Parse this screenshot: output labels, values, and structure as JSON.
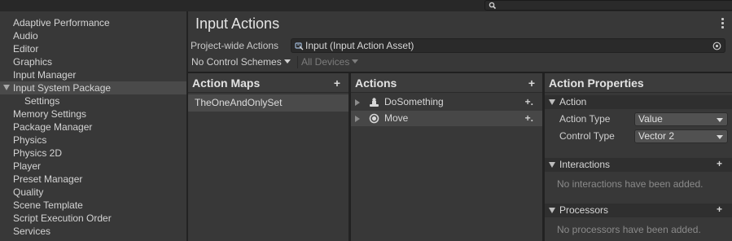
{
  "sidebar": {
    "items": [
      {
        "label": "Adaptive Performance"
      },
      {
        "label": "Audio"
      },
      {
        "label": "Editor"
      },
      {
        "label": "Graphics"
      },
      {
        "label": "Input Manager"
      },
      {
        "label": "Input System Package"
      },
      {
        "label": "Settings"
      },
      {
        "label": "Memory Settings"
      },
      {
        "label": "Package Manager"
      },
      {
        "label": "Physics"
      },
      {
        "label": "Physics 2D"
      },
      {
        "label": "Player"
      },
      {
        "label": "Preset Manager"
      },
      {
        "label": "Quality"
      },
      {
        "label": "Scene Template"
      },
      {
        "label": "Script Execution Order"
      },
      {
        "label": "Services"
      }
    ]
  },
  "header": {
    "title": "Input Actions",
    "project_label": "Project-wide Actions",
    "asset_value": "Input (Input Action Asset)"
  },
  "toolbar": {
    "control_schemes": "No Control Schemes",
    "devices": "All Devices"
  },
  "maps": {
    "title": "Action Maps",
    "add": "+",
    "items": [
      {
        "label": "TheOneAndOnlySet"
      }
    ]
  },
  "actions": {
    "title": "Actions",
    "add": "+",
    "items": [
      {
        "label": "DoSomething",
        "icon": "button-action-icon"
      },
      {
        "label": "Move",
        "icon": "value-action-icon"
      }
    ],
    "row_add": "+."
  },
  "properties": {
    "title": "Action Properties",
    "action_section": "Action",
    "action_type_label": "Action Type",
    "action_type_value": "Value",
    "control_type_label": "Control Type",
    "control_type_value": "Vector 2",
    "interactions_section": "Interactions",
    "interactions_empty": "No interactions have been added.",
    "processors_section": "Processors",
    "processors_empty": "No processors have been added.",
    "add": "+"
  }
}
